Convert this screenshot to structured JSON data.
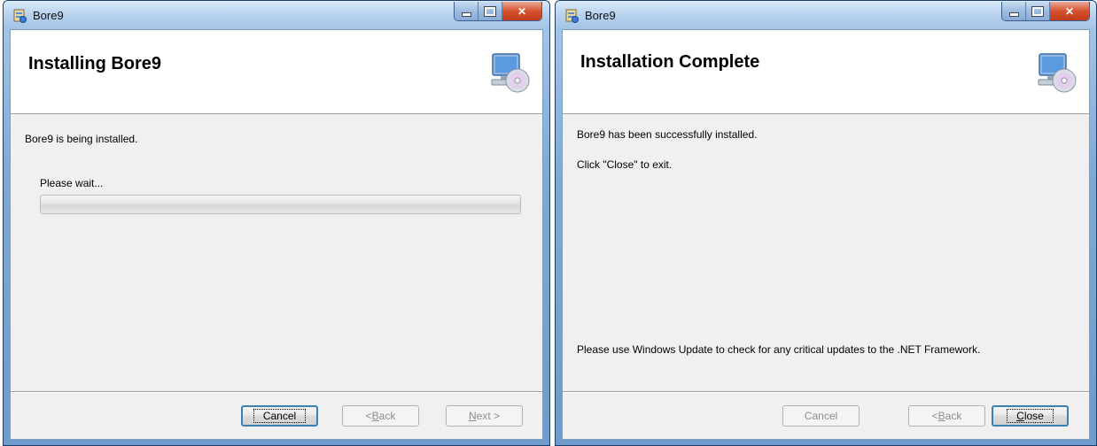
{
  "windows": [
    {
      "title": "Bore9",
      "header_title": "Installing Bore9",
      "status_text": "Bore9 is being installed.",
      "progress_label": "Please wait...",
      "progress_fraction": 0,
      "buttons": {
        "cancel": {
          "label": "Cancel",
          "default": true,
          "enabled": true
        },
        "back": {
          "prefix": "< ",
          "mnemonic": "B",
          "rest": "ack",
          "enabled": false
        },
        "next": {
          "prefix": "",
          "mnemonic": "N",
          "rest": "ext >",
          "enabled": false
        }
      }
    },
    {
      "title": "Bore9",
      "header_title": "Installation Complete",
      "status_text": "Bore9 has been successfully installed.",
      "instruction_text": "Click \"Close\" to exit.",
      "update_text": "Please use Windows Update to check for any critical updates to the .NET Framework.",
      "buttons": {
        "cancel": {
          "label": "Cancel",
          "enabled": false
        },
        "back": {
          "prefix": "< ",
          "mnemonic": "B",
          "rest": "ack",
          "enabled": false
        },
        "close": {
          "prefix": "",
          "mnemonic": "C",
          "rest": "lose",
          "default": true,
          "enabled": true
        }
      }
    }
  ],
  "icons": {
    "app_icon": "installer-app-icon",
    "setup_icon": "computer-cd-setup-icon",
    "minimize": "minimize-icon",
    "maximize": "maximize-icon",
    "close": "close-icon"
  },
  "colors": {
    "titlebar": "#b9d3ef",
    "close_button": "#c94a2a",
    "dialog_bg": "#f0f0f0",
    "default_button_border": "#3c7fb1"
  }
}
